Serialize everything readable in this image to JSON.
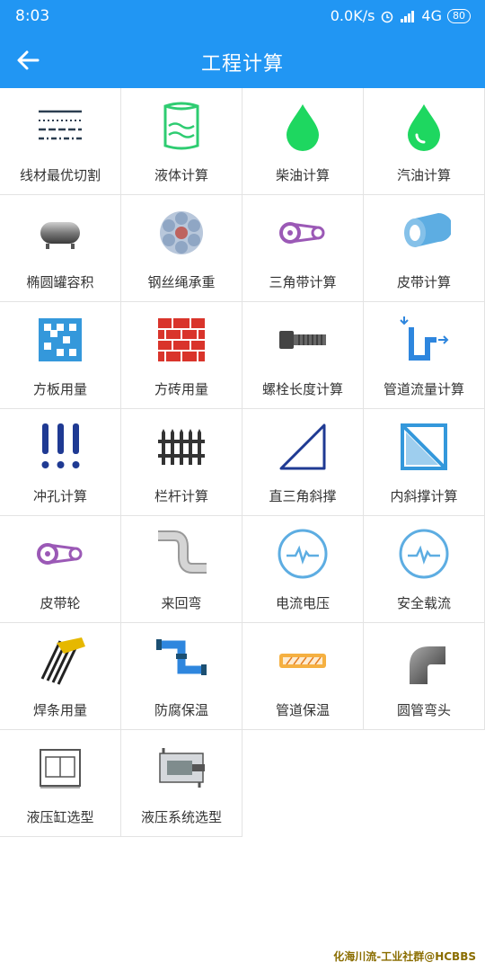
{
  "status": {
    "time": "8:03",
    "network": "0.0K/s",
    "signal": "4G",
    "battery": "80"
  },
  "header": {
    "title": "工程计算"
  },
  "items": [
    {
      "label": "线材最优切割",
      "icon": "dashed-lines-icon"
    },
    {
      "label": "液体计算",
      "icon": "liquid-cylinder-icon"
    },
    {
      "label": "柴油计算",
      "icon": "green-drop-icon"
    },
    {
      "label": "汽油计算",
      "icon": "green-drop-outline-icon"
    },
    {
      "label": "椭圆罐容积",
      "icon": "tank-icon"
    },
    {
      "label": "钢丝绳承重",
      "icon": "wire-rope-icon"
    },
    {
      "label": "三角带计算",
      "icon": "v-belt-icon"
    },
    {
      "label": "皮带计算",
      "icon": "belt-roll-icon"
    },
    {
      "label": "方板用量",
      "icon": "plate-grid-icon"
    },
    {
      "label": "方砖用量",
      "icon": "brick-icon"
    },
    {
      "label": "螺栓长度计算",
      "icon": "bolt-icon"
    },
    {
      "label": "管道流量计算",
      "icon": "pipe-flow-icon"
    },
    {
      "label": "冲孔计算",
      "icon": "punch-icon"
    },
    {
      "label": "栏杆计算",
      "icon": "fence-icon"
    },
    {
      "label": "直三角斜撑",
      "icon": "right-triangle-icon"
    },
    {
      "label": "内斜撑计算",
      "icon": "inner-brace-icon"
    },
    {
      "label": "皮带轮",
      "icon": "pulley-icon"
    },
    {
      "label": "来回弯",
      "icon": "s-bend-icon"
    },
    {
      "label": "电流电压",
      "icon": "current-voltage-icon"
    },
    {
      "label": "安全载流",
      "icon": "safe-current-icon"
    },
    {
      "label": "焊条用量",
      "icon": "welding-rod-icon"
    },
    {
      "label": "防腐保温",
      "icon": "anticorrosion-pipe-icon"
    },
    {
      "label": "管道保温",
      "icon": "pipe-insulation-icon"
    },
    {
      "label": "圆管弯头",
      "icon": "elbow-icon"
    },
    {
      "label": "液压缸选型",
      "icon": "hydraulic-cylinder-icon"
    },
    {
      "label": "液压系统选型",
      "icon": "hydraulic-system-icon"
    }
  ],
  "watermark": "化海川流-工业社群@HCBBS"
}
